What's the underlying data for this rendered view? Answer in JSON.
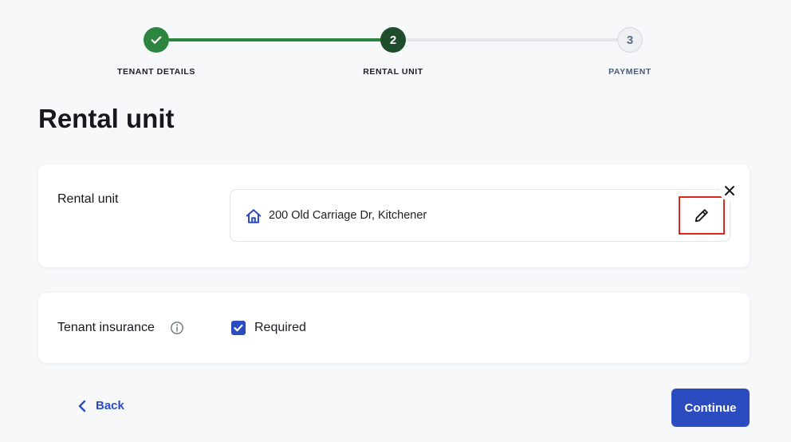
{
  "stepper": {
    "steps": [
      {
        "label": "TENANT DETAILS",
        "state": "complete",
        "icon": "check-icon"
      },
      {
        "label": "RENTAL UNIT",
        "number": "2",
        "state": "current"
      },
      {
        "label": "PAYMENT",
        "number": "3",
        "state": "upcoming"
      }
    ]
  },
  "page": {
    "title": "Rental unit"
  },
  "rental_unit": {
    "label": "Rental unit",
    "address": "200 Old Carriage Dr, Kitchener",
    "address_icon": "house-icon",
    "edit_icon": "pencil-icon",
    "remove_icon": "close-icon"
  },
  "tenant_insurance": {
    "label": "Tenant insurance",
    "info_icon": "info-icon",
    "checkbox_label": "Required",
    "checked": true
  },
  "footer": {
    "back_label": "Back",
    "continue_label": "Continue"
  },
  "colors": {
    "accent": "#2b4cc0",
    "success": "#2e8540",
    "current_step": "#1e4d2b",
    "highlight": "#e0251b",
    "background": "#f7f8fa"
  }
}
